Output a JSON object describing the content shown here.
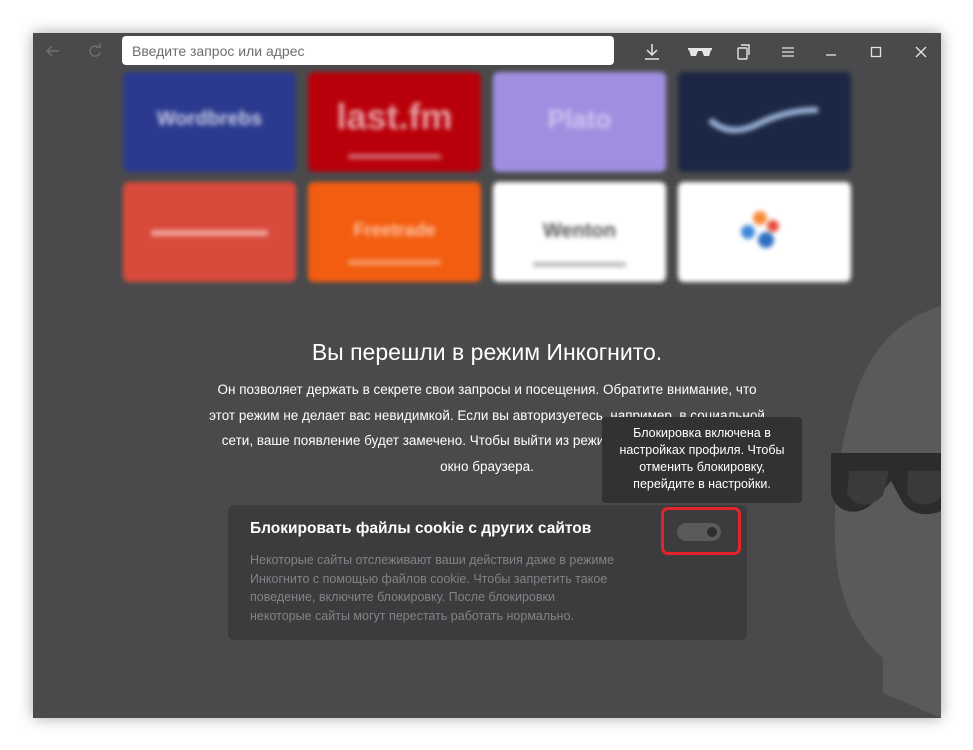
{
  "toolbar": {
    "address_placeholder": "Введите запрос или адрес",
    "icons": [
      "back-arrow-icon",
      "reload-icon",
      "download-icon",
      "incognito-glasses-icon",
      "collections-icon",
      "menu-icon",
      "minimize-icon",
      "maximize-icon",
      "close-icon"
    ]
  },
  "tiles": [
    {
      "label": "Wordbrebs",
      "color": "#2b3a8f"
    },
    {
      "label": "last.fm",
      "color": "#b9000a"
    },
    {
      "label": "Plato",
      "color": "#a08fe0"
    },
    {
      "label": "",
      "color": "#1b2744"
    },
    {
      "label": "",
      "color": "#d84a3c"
    },
    {
      "label": "Freetrade",
      "color": "#f25d10"
    },
    {
      "label": "Wenton",
      "color": "#ffffff"
    },
    {
      "label": "",
      "color": "#ffffff"
    }
  ],
  "main": {
    "title": "Вы перешли в режим Инкогнито.",
    "intro_lines": [
      "Он позволяет держать в секрете свои запросы и посещения. Обратите внимание, что",
      "этот режим не делает вас невидимкой. Если вы авторизуетесь, например, в социальной",
      "сети, ваше появление будет замечено. Чтобы выйти из режима Инкогнито, закройте",
      "окно браузера."
    ]
  },
  "cookie_card": {
    "title": "Блокировать файлы cookie с других сайтов",
    "desc_lines": [
      "Некоторые сайты отслеживают ваши действия даже в режиме",
      "Инкогнито с помощью файлов cookie. Чтобы запретить такое",
      "поведение, включите блокировку. После блокировки",
      "некоторые сайты могут перестать работать нормально."
    ],
    "toggle_on": true,
    "highlight_color": "#e2242c"
  },
  "tooltip": {
    "lines": [
      "Блокировка включена в",
      "настройках профиля. Чтобы",
      "отменить блокировку,",
      "перейдите в настройки."
    ]
  }
}
